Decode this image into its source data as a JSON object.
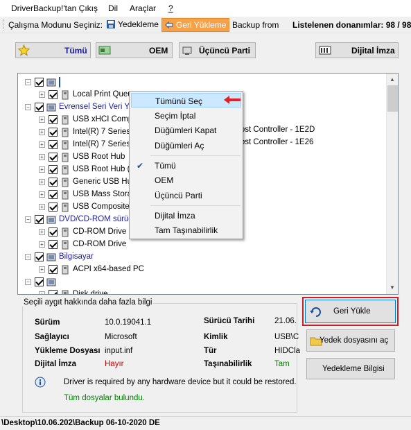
{
  "menu": {
    "exit": "DriverBackup!'tan Çıkış",
    "language": "Dil",
    "tools": "Araçlar",
    "help": "?"
  },
  "toolbar": {
    "mode_label": "Çalışma Modunu Seçiniz:",
    "backup": "Yedekleme",
    "restore": "Geri Yükleme",
    "backup_from": "Backup from",
    "listed_count": "Listelenen donanımlar: 98 / 98"
  },
  "filters": {
    "all": "Tümü",
    "oem": "OEM",
    "third_party": "Üçüncü Parti",
    "digital_signature": "Dijital İmza"
  },
  "tree": {
    "rows": [
      {
        "label": ""
      },
      {
        "label": "Local Print Queue"
      },
      {
        "label": "Evrensel Seri Veri Yolu"
      },
      {
        "label": "USB xHCI Compl"
      },
      {
        "label": "Intel(R) 7 Series/"
      },
      {
        "label": "Intel(R) 7 Series/"
      },
      {
        "label": "USB Root Hub"
      },
      {
        "label": "USB Root Hub (I"
      },
      {
        "label": "Generic USB Hu"
      },
      {
        "label": "USB Mass Storag"
      },
      {
        "label": "USB Composite I"
      },
      {
        "label": "DVD/CD-ROM sürüc"
      },
      {
        "label": "CD-ROM Drive"
      },
      {
        "label": "CD-ROM Drive"
      },
      {
        "label": "Bilgisayar"
      },
      {
        "label": "ACPI x64-based PC"
      },
      {
        "label": ""
      },
      {
        "label": "Disk drive"
      }
    ],
    "overflow_texts": [
      "d Host Controller - 1E2D",
      "d Host Controller - 1E26"
    ]
  },
  "context_menu": {
    "items": [
      {
        "label": "Tümünü Seç"
      },
      {
        "label": "Seçim İptal"
      },
      {
        "label": "Düğümleri Kapat"
      },
      {
        "label": "Düğümleri Aç"
      },
      {
        "label": "Tümü"
      },
      {
        "label": "OEM"
      },
      {
        "label": "Üçüncü Parti"
      },
      {
        "label": "Dijital İmza"
      },
      {
        "label": "Tam Taşınabilirlik"
      }
    ]
  },
  "info": {
    "title": "Seçili aygıt hakkında daha fazla bilgi",
    "version_label": "Sürüm",
    "version_value": "10.0.19041.1",
    "driver_date_label": "Sürücü Tarihi",
    "driver_date_value": "21.06.",
    "provider_label": "Sağlayıcı",
    "provider_value": "Microsoft",
    "id_label": "Kimlik",
    "id_value": "USB\\C",
    "inf_label": "Yükleme Dosyası",
    "inf_value": "input.inf",
    "type_label": "Tür",
    "type_value": "HIDCla",
    "signature_label": "Dijital İmza",
    "signature_value": "Hayır",
    "portability_label": "Taşınabilirlik",
    "portability_value": "Tam",
    "note": "Driver is required by any hardware device but it could be restored.",
    "files_found": "Tüm dosyalar bulundu."
  },
  "actions": {
    "restore": "Geri Yükle",
    "open_backup_file": "Yedek dosyasını aç",
    "backup_info": "Yedekleme Bilgisi"
  },
  "status": {
    "path": "\\Desktop\\10.06.202\\Backup 06-10-2020  DE"
  },
  "colors": {
    "active_mode": "#f5a14a",
    "category_text": "#1a1aa6",
    "no_value": "#cc0000",
    "yes_value": "#008000",
    "highlight": "#cce8ff",
    "restore_outline": "#c8202a"
  }
}
